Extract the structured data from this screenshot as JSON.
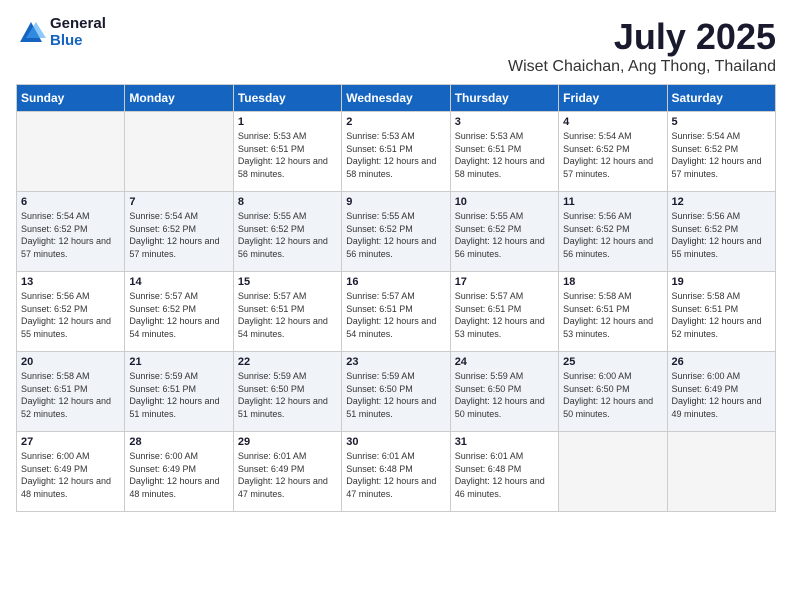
{
  "logo": {
    "general": "General",
    "blue": "Blue"
  },
  "header": {
    "month_year": "July 2025",
    "location": "Wiset Chaichan, Ang Thong, Thailand"
  },
  "weekdays": [
    "Sunday",
    "Monday",
    "Tuesday",
    "Wednesday",
    "Thursday",
    "Friday",
    "Saturday"
  ],
  "weeks": [
    [
      {
        "day": "",
        "empty": true
      },
      {
        "day": "",
        "empty": true
      },
      {
        "day": "1",
        "sunrise": "5:53 AM",
        "sunset": "6:51 PM",
        "daylight": "12 hours and 58 minutes."
      },
      {
        "day": "2",
        "sunrise": "5:53 AM",
        "sunset": "6:51 PM",
        "daylight": "12 hours and 58 minutes."
      },
      {
        "day": "3",
        "sunrise": "5:53 AM",
        "sunset": "6:51 PM",
        "daylight": "12 hours and 58 minutes."
      },
      {
        "day": "4",
        "sunrise": "5:54 AM",
        "sunset": "6:52 PM",
        "daylight": "12 hours and 57 minutes."
      },
      {
        "day": "5",
        "sunrise": "5:54 AM",
        "sunset": "6:52 PM",
        "daylight": "12 hours and 57 minutes."
      }
    ],
    [
      {
        "day": "6",
        "sunrise": "5:54 AM",
        "sunset": "6:52 PM",
        "daylight": "12 hours and 57 minutes."
      },
      {
        "day": "7",
        "sunrise": "5:54 AM",
        "sunset": "6:52 PM",
        "daylight": "12 hours and 57 minutes."
      },
      {
        "day": "8",
        "sunrise": "5:55 AM",
        "sunset": "6:52 PM",
        "daylight": "12 hours and 56 minutes."
      },
      {
        "day": "9",
        "sunrise": "5:55 AM",
        "sunset": "6:52 PM",
        "daylight": "12 hours and 56 minutes."
      },
      {
        "day": "10",
        "sunrise": "5:55 AM",
        "sunset": "6:52 PM",
        "daylight": "12 hours and 56 minutes."
      },
      {
        "day": "11",
        "sunrise": "5:56 AM",
        "sunset": "6:52 PM",
        "daylight": "12 hours and 56 minutes."
      },
      {
        "day": "12",
        "sunrise": "5:56 AM",
        "sunset": "6:52 PM",
        "daylight": "12 hours and 55 minutes."
      }
    ],
    [
      {
        "day": "13",
        "sunrise": "5:56 AM",
        "sunset": "6:52 PM",
        "daylight": "12 hours and 55 minutes."
      },
      {
        "day": "14",
        "sunrise": "5:57 AM",
        "sunset": "6:52 PM",
        "daylight": "12 hours and 54 minutes."
      },
      {
        "day": "15",
        "sunrise": "5:57 AM",
        "sunset": "6:51 PM",
        "daylight": "12 hours and 54 minutes."
      },
      {
        "day": "16",
        "sunrise": "5:57 AM",
        "sunset": "6:51 PM",
        "daylight": "12 hours and 54 minutes."
      },
      {
        "day": "17",
        "sunrise": "5:57 AM",
        "sunset": "6:51 PM",
        "daylight": "12 hours and 53 minutes."
      },
      {
        "day": "18",
        "sunrise": "5:58 AM",
        "sunset": "6:51 PM",
        "daylight": "12 hours and 53 minutes."
      },
      {
        "day": "19",
        "sunrise": "5:58 AM",
        "sunset": "6:51 PM",
        "daylight": "12 hours and 52 minutes."
      }
    ],
    [
      {
        "day": "20",
        "sunrise": "5:58 AM",
        "sunset": "6:51 PM",
        "daylight": "12 hours and 52 minutes."
      },
      {
        "day": "21",
        "sunrise": "5:59 AM",
        "sunset": "6:51 PM",
        "daylight": "12 hours and 51 minutes."
      },
      {
        "day": "22",
        "sunrise": "5:59 AM",
        "sunset": "6:50 PM",
        "daylight": "12 hours and 51 minutes."
      },
      {
        "day": "23",
        "sunrise": "5:59 AM",
        "sunset": "6:50 PM",
        "daylight": "12 hours and 51 minutes."
      },
      {
        "day": "24",
        "sunrise": "5:59 AM",
        "sunset": "6:50 PM",
        "daylight": "12 hours and 50 minutes."
      },
      {
        "day": "25",
        "sunrise": "6:00 AM",
        "sunset": "6:50 PM",
        "daylight": "12 hours and 50 minutes."
      },
      {
        "day": "26",
        "sunrise": "6:00 AM",
        "sunset": "6:49 PM",
        "daylight": "12 hours and 49 minutes."
      }
    ],
    [
      {
        "day": "27",
        "sunrise": "6:00 AM",
        "sunset": "6:49 PM",
        "daylight": "12 hours and 48 minutes."
      },
      {
        "day": "28",
        "sunrise": "6:00 AM",
        "sunset": "6:49 PM",
        "daylight": "12 hours and 48 minutes."
      },
      {
        "day": "29",
        "sunrise": "6:01 AM",
        "sunset": "6:49 PM",
        "daylight": "12 hours and 47 minutes."
      },
      {
        "day": "30",
        "sunrise": "6:01 AM",
        "sunset": "6:48 PM",
        "daylight": "12 hours and 47 minutes."
      },
      {
        "day": "31",
        "sunrise": "6:01 AM",
        "sunset": "6:48 PM",
        "daylight": "12 hours and 46 minutes."
      },
      {
        "day": "",
        "empty": true
      },
      {
        "day": "",
        "empty": true
      }
    ]
  ]
}
